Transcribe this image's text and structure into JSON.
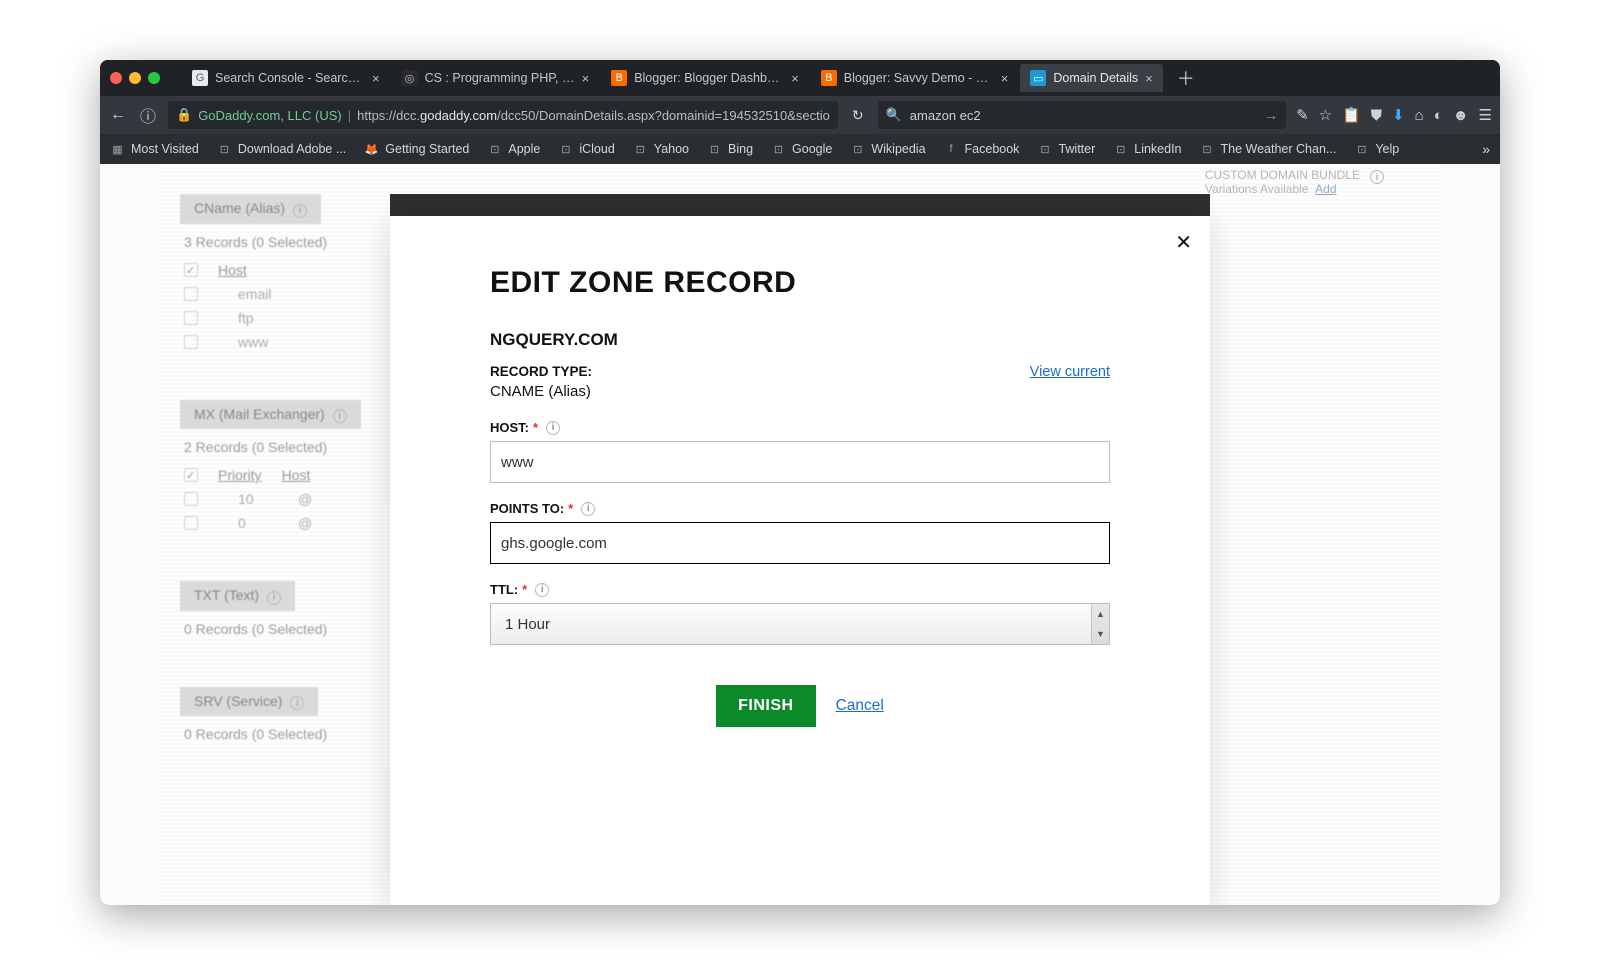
{
  "browser": {
    "tabs": [
      {
        "title": "Search Console - Search A...",
        "favicon_bg": "#e8eaed",
        "favicon_fg": "#5f6368",
        "favicon_glyph": "G"
      },
      {
        "title": "CS : Programming PHP, JQ...",
        "favicon_bg": "#2b2b2b",
        "favicon_fg": "#bdbdbd",
        "favicon_glyph": "◎"
      },
      {
        "title": "Blogger: Blogger Dashboard",
        "favicon_bg": "#ff6a00",
        "favicon_fg": "#fff",
        "favicon_glyph": "B"
      },
      {
        "title": "Blogger: Savvy Demo - Bas...",
        "favicon_bg": "#ff6a00",
        "favicon_fg": "#fff",
        "favicon_glyph": "B"
      },
      {
        "title": "Domain Details",
        "favicon_bg": "#1b9ad6",
        "favicon_fg": "#fff",
        "favicon_glyph": "▭",
        "active": true
      }
    ],
    "identity": "GoDaddy.com, LLC (US)",
    "url_prefix": "https://dcc.",
    "url_bold": "godaddy.com",
    "url_suffix": "/dcc50/DomainDetails.aspx?domainid=194532510&sectio",
    "search_value": "amazon ec2",
    "bookmarks": [
      "Most Visited",
      "Download Adobe ...",
      "Getting Started",
      "Apple",
      "iCloud",
      "Yahoo",
      "Bing",
      "Google",
      "Wikipedia",
      "Facebook",
      "Twitter",
      "LinkedIn",
      "The Weather Chan...",
      "Yelp"
    ]
  },
  "background": {
    "right_bundle_line1": "CUSTOM DOMAIN BUNDLE",
    "right_bundle_line2": "Variations Available",
    "right_add": "Add",
    "sections": [
      {
        "title": "CName (Alias)",
        "sub": "3 Records (0 Selected)",
        "type": "cname",
        "head": "Host",
        "rows": [
          {
            "host": "email"
          },
          {
            "host": "ftp"
          },
          {
            "host": "www"
          }
        ]
      },
      {
        "title": "MX (Mail Exchanger)",
        "sub": "2 Records (0 Selected)",
        "type": "mx",
        "head1": "Priority",
        "head2": "Host",
        "rows": [
          {
            "priority": "10",
            "host": "@"
          },
          {
            "priority": "0",
            "host": "@"
          }
        ]
      },
      {
        "title": "TXT (Text)",
        "sub": "0 Records (0 Selected)",
        "type": "txt",
        "rows": []
      },
      {
        "title": "SRV (Service)",
        "sub": "0 Records (0 Selected)",
        "type": "srv",
        "rows": []
      }
    ]
  },
  "modal": {
    "title": "EDIT ZONE RECORD",
    "domain": "NGQUERY.COM",
    "record_type_label": "RECORD TYPE:",
    "record_type_value": "CNAME (Alias)",
    "view_current": "View current",
    "host_label": "HOST:",
    "host_value": "www",
    "points_label": "POINTS TO:",
    "points_value": "ghs.google.com",
    "ttl_label": "TTL:",
    "ttl_value": "1 Hour",
    "finish": "FINISH",
    "cancel": "Cancel"
  }
}
